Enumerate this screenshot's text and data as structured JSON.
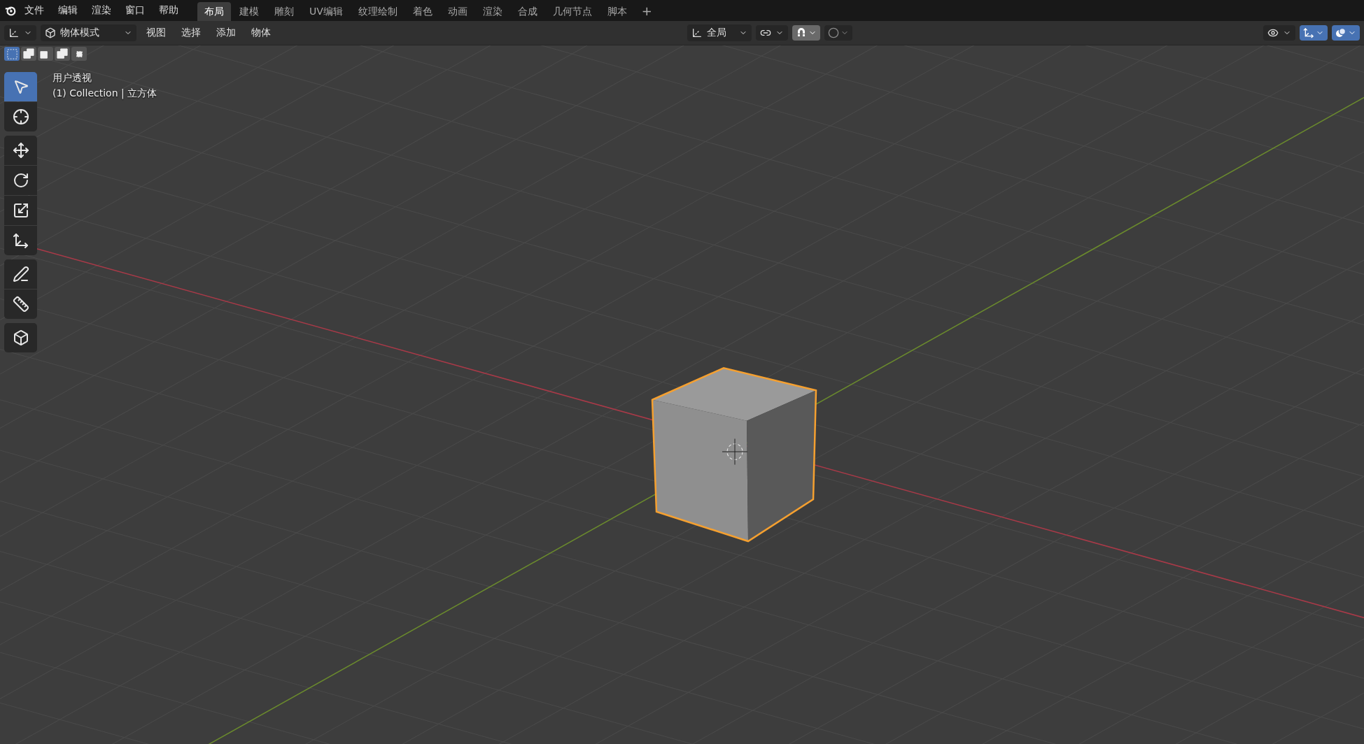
{
  "menu": [
    "文件",
    "编辑",
    "渲染",
    "窗口",
    "帮助"
  ],
  "workspaces": [
    {
      "label": "布局",
      "selected": true
    },
    {
      "label": "建模",
      "selected": false
    },
    {
      "label": "雕刻",
      "selected": false
    },
    {
      "label": "UV编辑",
      "selected": false
    },
    {
      "label": "纹理绘制",
      "selected": false
    },
    {
      "label": "着色",
      "selected": false
    },
    {
      "label": "动画",
      "selected": false
    },
    {
      "label": "渲染",
      "selected": false
    },
    {
      "label": "合成",
      "selected": false
    },
    {
      "label": "几何节点",
      "selected": false
    },
    {
      "label": "脚本",
      "selected": false
    }
  ],
  "add_workspace": "+",
  "header": {
    "mode": "物体模式",
    "menus": [
      "视图",
      "选择",
      "添加",
      "物体"
    ],
    "orientation": "全局",
    "snap": {
      "on": true
    },
    "proportional": {
      "on": false
    },
    "gizmo": {
      "on": true
    },
    "overlays": {
      "on": true
    }
  },
  "select_modes": [
    {
      "kind": "new",
      "selected": true
    },
    {
      "kind": "extend",
      "selected": false
    },
    {
      "kind": "subtract",
      "selected": false
    },
    {
      "kind": "invert",
      "selected": false
    },
    {
      "kind": "intersect",
      "selected": false
    }
  ],
  "tools": [
    {
      "kind": "select",
      "selected": true
    },
    {
      "kind": "cursor",
      "selected": false
    },
    {
      "kind": "move",
      "selected": false
    },
    {
      "kind": "rotate",
      "selected": false
    },
    {
      "kind": "scale",
      "selected": false
    },
    {
      "kind": "transform",
      "selected": false
    },
    {
      "kind": "annotate",
      "selected": false
    },
    {
      "kind": "measure",
      "selected": false
    },
    {
      "kind": "add_cube",
      "selected": false
    }
  ],
  "viewport": {
    "view_name": "用户透视",
    "context": "(1) Collection | 立方体"
  }
}
